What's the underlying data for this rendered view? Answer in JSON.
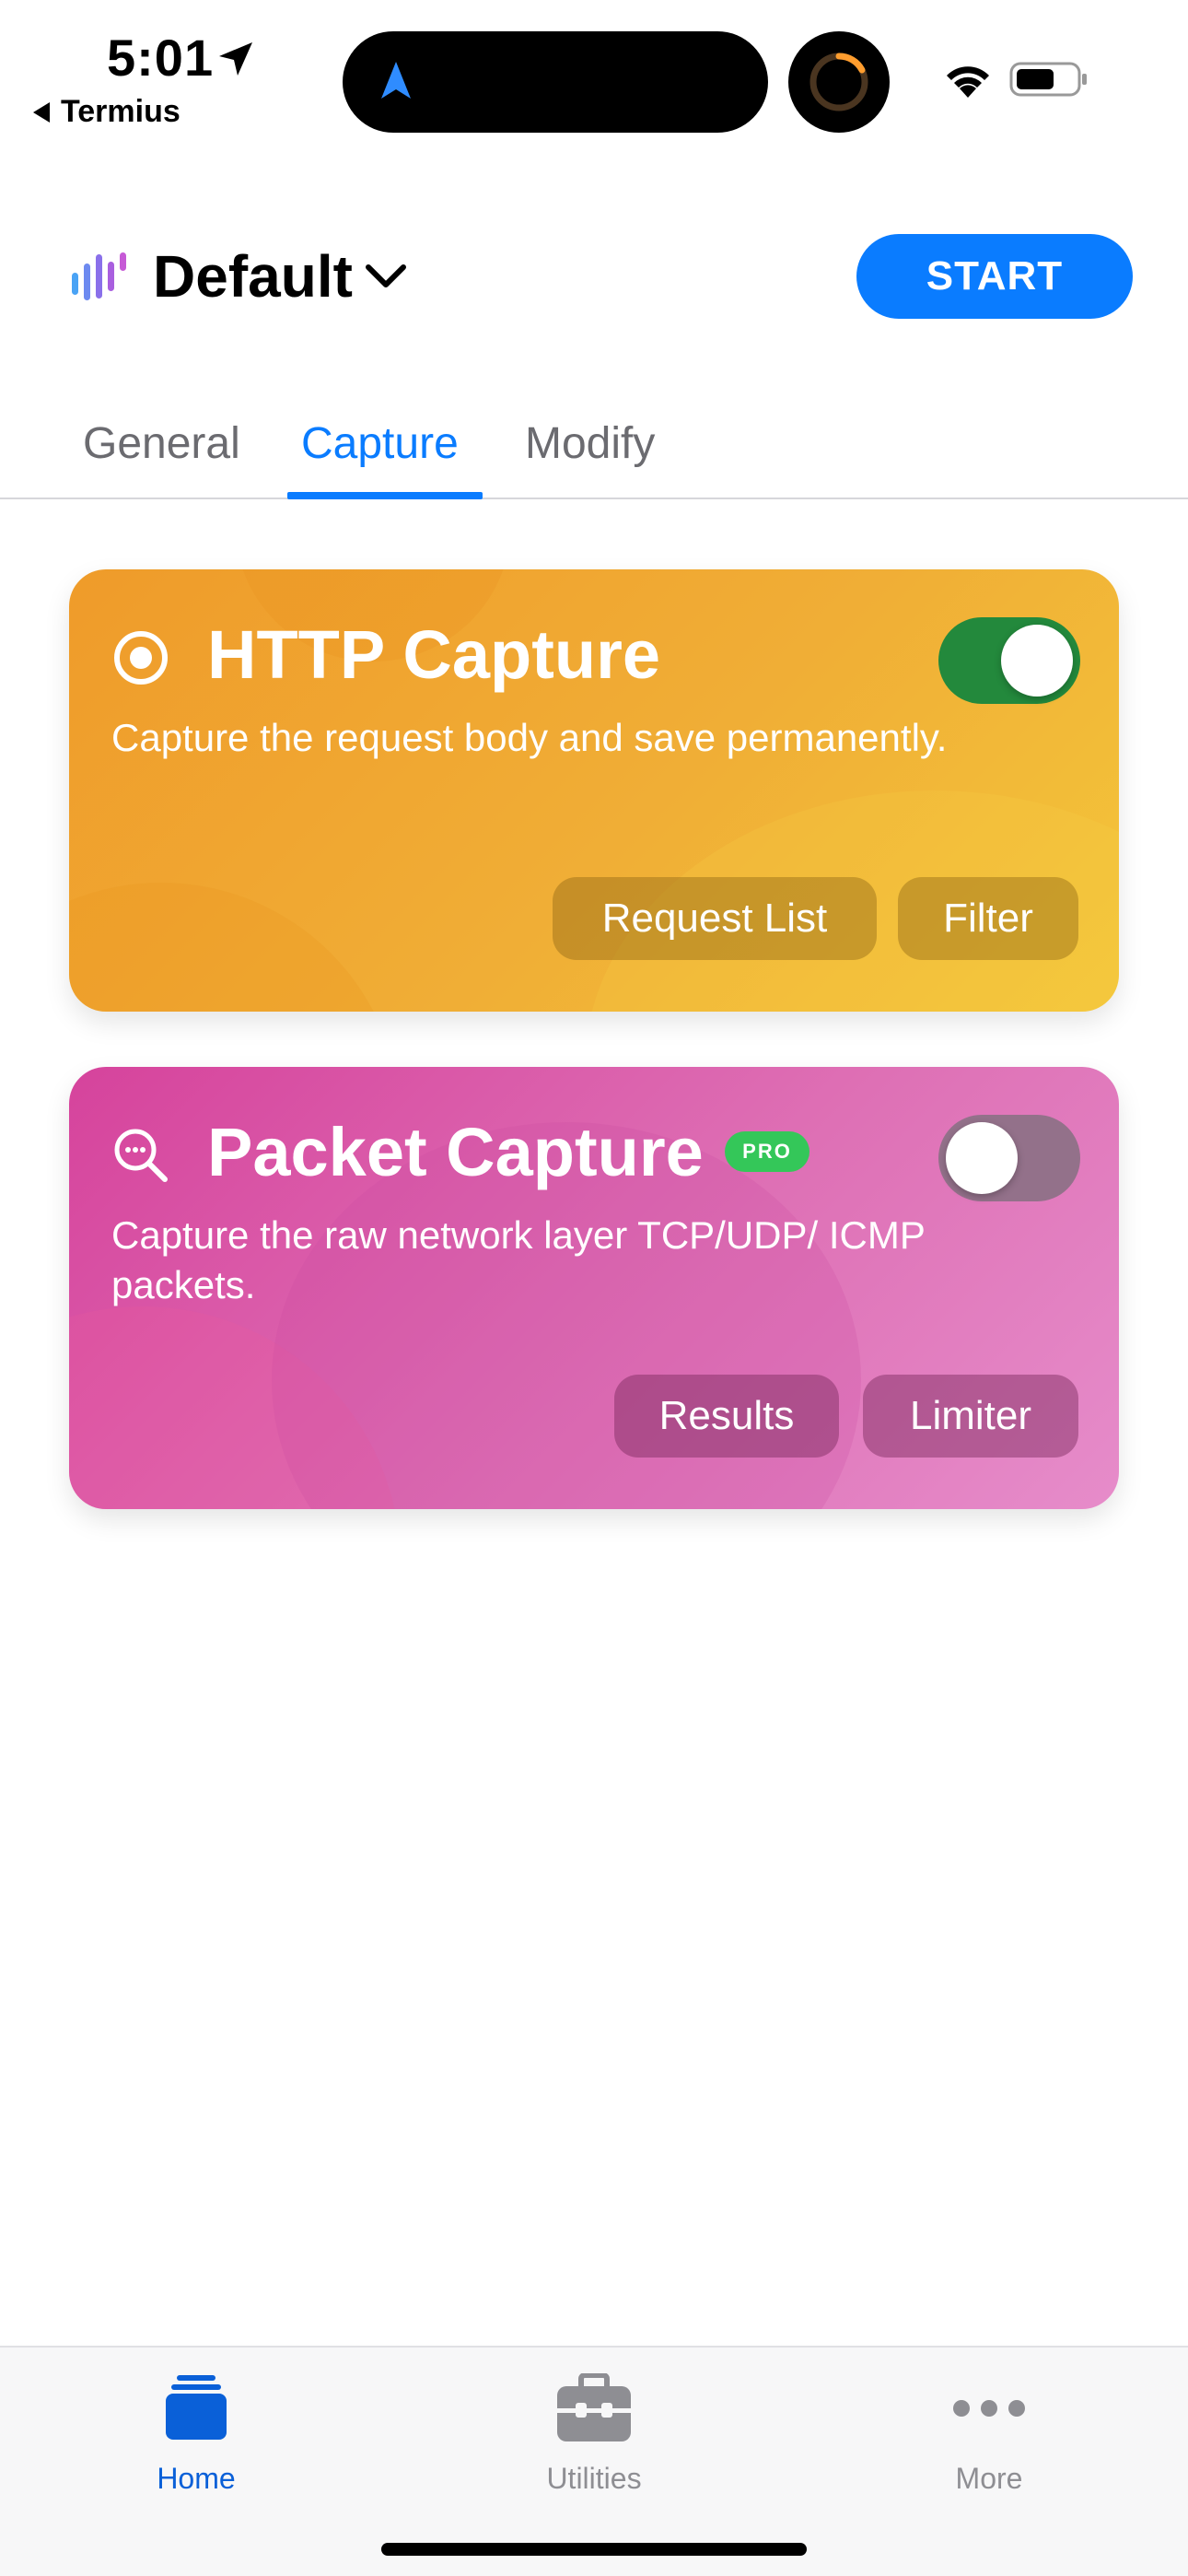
{
  "status_bar": {
    "time": "5:01",
    "back_app": "Termius"
  },
  "header": {
    "profile_name": "Default",
    "start_label": "START"
  },
  "tabs": [
    {
      "label": "General",
      "active": false
    },
    {
      "label": "Capture",
      "active": true
    },
    {
      "label": "Modify",
      "active": false
    }
  ],
  "cards": {
    "http": {
      "title": "HTTP Capture",
      "description": "Capture the request body and save permanently.",
      "enabled": true,
      "buttons": [
        "Request List",
        "Filter"
      ]
    },
    "packet": {
      "title": "Packet Capture",
      "badge": "PRO",
      "description": "Capture the raw network layer TCP/UDP/ ICMP packets.",
      "enabled": false,
      "buttons": [
        "Results",
        "Limiter"
      ]
    }
  },
  "tabbar": [
    {
      "label": "Home",
      "icon": "stack-icon",
      "active": true
    },
    {
      "label": "Utilities",
      "icon": "toolbox-icon",
      "active": false
    },
    {
      "label": "More",
      "icon": "ellipsis-icon",
      "active": false
    }
  ],
  "colors": {
    "accent": "#0a7cff",
    "http_card": "#f0ae36",
    "packet_card": "#de70b5",
    "toggle_on": "#23893c",
    "pro_badge": "#34c759"
  }
}
